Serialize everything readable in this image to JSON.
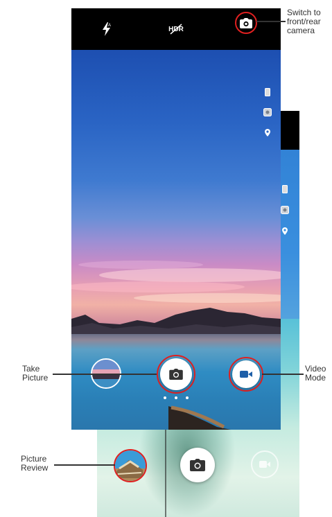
{
  "callouts": {
    "switch_camera": "Switch to\nfront/rear\ncamera",
    "take_picture": "Take\nPicture",
    "video_mode": "Video\nMode",
    "picture_review": "Picture\nReview"
  },
  "topbar": {
    "hdr_label": "HDR"
  },
  "mode_indicator": {
    "dots": 3,
    "active_index": 1
  },
  "colors": {
    "highlight_ring": "#e02020",
    "topbar_bg": "#000000",
    "button_bg": "#ffffff",
    "camera_glyph": "#333333",
    "video_glyph": "#1e5fa8"
  },
  "icons": {
    "flash": "flash-auto-icon",
    "hdr": "hdr-off-icon",
    "switch_camera": "switch-camera-icon",
    "aspect": "aspect-ratio-icon",
    "settings": "settings-icon",
    "location": "location-icon",
    "shutter": "camera-icon",
    "video": "video-camera-icon",
    "thumbnail": "gallery-thumbnail"
  }
}
